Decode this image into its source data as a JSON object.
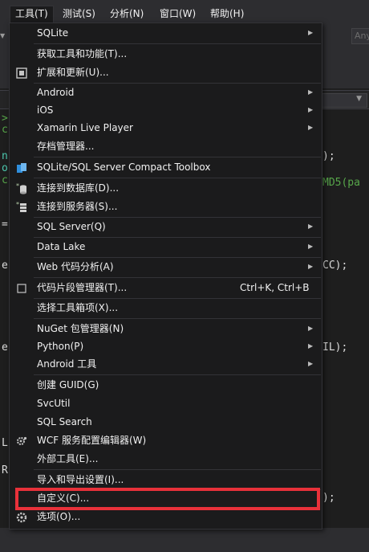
{
  "menubar": {
    "items": [
      {
        "label": "工具(T)"
      },
      {
        "label": "测试(S)"
      },
      {
        "label": "分析(N)"
      },
      {
        "label": "窗口(W)"
      },
      {
        "label": "帮助(H)"
      }
    ]
  },
  "toolbar": {
    "combo_text": "Any"
  },
  "code": {
    "lines": [
      ");",
      "MD5(pa",
      "CC);",
      "IL);",
      ");",
      "L",
      "R"
    ],
    "gutter": [
      ">",
      "c",
      "n",
      "o",
      "c",
      "=",
      "e",
      "e"
    ]
  },
  "menu": {
    "items": [
      {
        "label": "SQLite",
        "submenu": true
      },
      {
        "label": "获取工具和功能(T)..."
      },
      {
        "label": "扩展和更新(U)...",
        "icon": "extensions-icon"
      },
      {
        "label": "Android",
        "submenu": true
      },
      {
        "label": "iOS",
        "submenu": true
      },
      {
        "label": "Xamarin Live Player",
        "submenu": true
      },
      {
        "label": "存档管理器..."
      },
      {
        "label": "SQLite/SQL Server Compact Toolbox",
        "icon": "database-toolbox-icon"
      },
      {
        "label": "连接到数据库(D)...",
        "icon": "connect-database-icon"
      },
      {
        "label": "连接到服务器(S)...",
        "icon": "connect-server-icon"
      },
      {
        "label": "SQL Server(Q)",
        "submenu": true
      },
      {
        "label": "Data Lake",
        "submenu": true
      },
      {
        "label": "Web 代码分析(A)",
        "submenu": true
      },
      {
        "label": "代码片段管理器(T)...",
        "shortcut": "Ctrl+K, Ctrl+B",
        "icon": "snippet-icon"
      },
      {
        "label": "选择工具箱项(X)..."
      },
      {
        "label": "NuGet 包管理器(N)",
        "submenu": true
      },
      {
        "label": "Python(P)",
        "submenu": true
      },
      {
        "label": "Android 工具",
        "submenu": true
      },
      {
        "label": "创建 GUID(G)"
      },
      {
        "label": "SvcUtil"
      },
      {
        "label": "SQL Search"
      },
      {
        "label": "WCF 服务配置编辑器(W)",
        "icon": "wcf-gear-icon"
      },
      {
        "label": "外部工具(E)..."
      },
      {
        "label": "导入和导出设置(I)..."
      },
      {
        "label": "自定义(C)..."
      },
      {
        "label": "选项(O)...",
        "icon": "options-gear-icon"
      }
    ]
  },
  "colors": {
    "highlight_border": "#e8313a",
    "menu_bg": "#1b1b1c",
    "code_green": "#57a64a",
    "accent_blue": "#2f8fdd"
  }
}
